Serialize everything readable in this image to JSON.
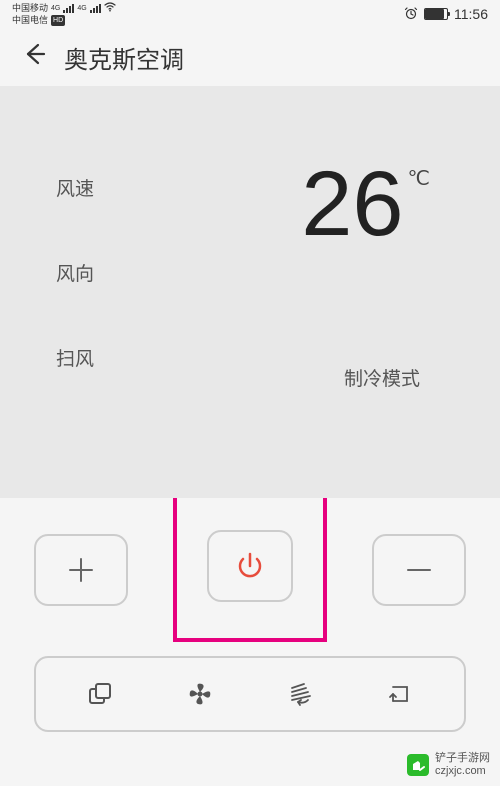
{
  "status": {
    "carrier1": "中国移动",
    "carrier2": "中国电信",
    "net_label": "4G",
    "hd_label": "HD",
    "time": "11:56"
  },
  "header": {
    "title": "奥克斯空调"
  },
  "controls": {
    "fan_speed": "风速",
    "fan_direction": "风向",
    "swing": "扫风"
  },
  "temperature": {
    "value": "26",
    "unit": "℃"
  },
  "mode": {
    "label": "制冷模式"
  },
  "watermark": {
    "line1": "铲子手游网",
    "line2": "czjxjc.com"
  }
}
